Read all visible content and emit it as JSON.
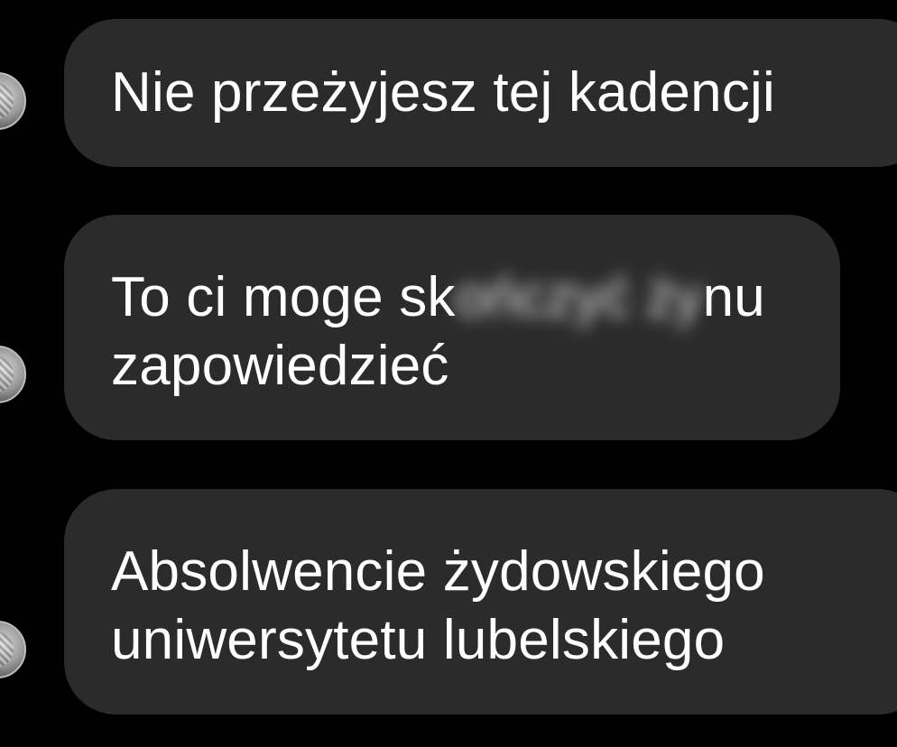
{
  "messages": [
    {
      "lines": [
        "Nie przeżyjesz tej kadencji"
      ]
    },
    {
      "line1_start": "To ci moge sk",
      "line1_redacted": "ończyć ży",
      "line1_end": "nu",
      "line2": "zapowiedzieć"
    },
    {
      "lines": [
        "Absolwencie żydowskiego",
        "uniwersytetu lubelskiego"
      ]
    }
  ],
  "colors": {
    "background": "#000000",
    "bubble": "#2b2b2b",
    "text": "#ffffff"
  },
  "icons": {
    "avatar": "sender-avatar"
  }
}
